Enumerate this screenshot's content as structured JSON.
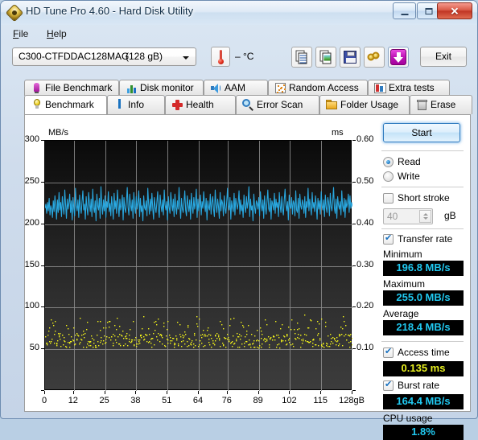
{
  "window": {
    "title": "HD Tune Pro 4.60 - Hard Disk Utility",
    "icon": "hdtune-logo-icon",
    "minimize": "",
    "maximize": "",
    "close": "✕"
  },
  "menu": {
    "items": [
      {
        "label": "File"
      },
      {
        "label": "Help"
      }
    ]
  },
  "toolbar": {
    "drive_name": "C300-CTFDDAC128MAG",
    "drive_size": "(128 gB)",
    "temperature": "– °C",
    "buttons": [
      {
        "name": "copy-text-icon"
      },
      {
        "name": "copy-image-icon"
      },
      {
        "name": "save-icon"
      },
      {
        "name": "links-icon"
      },
      {
        "name": "download-icon"
      }
    ],
    "exit_label": "Exit"
  },
  "tabs_top": [
    {
      "label": "File Benchmark",
      "icon": "file-benchmark-icon"
    },
    {
      "label": "Disk monitor",
      "icon": "bar-chart-icon"
    },
    {
      "label": "AAM",
      "icon": "speaker-icon"
    },
    {
      "label": "Random Access",
      "icon": "random-access-icon"
    },
    {
      "label": "Extra tests",
      "icon": "extra-tests-icon"
    }
  ],
  "tabs_bottom": [
    {
      "label": "Benchmark",
      "icon": "lightbulb-icon",
      "active": true
    },
    {
      "label": "Info",
      "icon": "info-icon",
      "active": false
    },
    {
      "label": "Health",
      "icon": "health-cross-icon",
      "active": false
    },
    {
      "label": "Error Scan",
      "icon": "magnifier-icon",
      "active": false
    },
    {
      "label": "Folder Usage",
      "icon": "folder-icon",
      "active": false
    },
    {
      "label": "Erase",
      "icon": "trash-icon",
      "active": false
    }
  ],
  "side": {
    "start_label": "Start",
    "read_label": "Read",
    "write_label": "Write",
    "read_selected": true,
    "short_stroke_label": "Short stroke",
    "short_stroke_checked": false,
    "short_stroke_value": "40",
    "short_stroke_unit": "gB",
    "transfer_rate_label": "Transfer rate",
    "transfer_rate_checked": true,
    "minimum_label": "Minimum",
    "minimum_value": "196.8 MB/s",
    "maximum_label": "Maximum",
    "maximum_value": "255.0 MB/s",
    "average_label": "Average",
    "average_value": "218.4 MB/s",
    "access_time_label": "Access time",
    "access_time_checked": true,
    "access_time_value": "0.135 ms",
    "burst_rate_label": "Burst rate",
    "burst_rate_checked": true,
    "burst_rate_value": "164.4 MB/s",
    "cpu_usage_label": "CPU usage",
    "cpu_usage_value": "1.8%"
  },
  "colors": {
    "transfer_line": "#29a8e0",
    "access_dots": "#f2f21a",
    "result_cyan": "#20c8f0",
    "result_yellow": "#e8f020",
    "accent": "#2f7bbf"
  },
  "chart_data": {
    "type": "line",
    "title": "",
    "xlabel": "",
    "ylabel": "MB/s",
    "y2label": "ms",
    "xlim": [
      0,
      128
    ],
    "ylim": [
      0,
      300
    ],
    "y2lim": [
      0.0,
      0.6
    ],
    "grid": true,
    "legend": "none",
    "xticks": [
      0,
      12,
      25,
      38,
      51,
      64,
      76,
      89,
      102,
      115,
      128
    ],
    "xtick_labels": [
      "0",
      "12",
      "25",
      "38",
      "51",
      "64",
      "76",
      "89",
      "102",
      "115",
      "128gB"
    ],
    "yticks": [
      0,
      50,
      100,
      150,
      200,
      250,
      300
    ],
    "ytick_labels": [
      "",
      "50",
      "100",
      "150",
      "200",
      "250",
      "300"
    ],
    "y2ticks": [
      0.0,
      0.1,
      0.2,
      0.3,
      0.4,
      0.5,
      0.6
    ],
    "y2tick_labels": [
      "",
      "0.10",
      "0.20",
      "0.30",
      "0.40",
      "0.50",
      "0.60"
    ],
    "series": [
      {
        "name": "Transfer rate",
        "type": "line",
        "axis": "left",
        "units": "MB/s",
        "color": "#29a8e0",
        "minimum": 196.8,
        "maximum": 255.0,
        "average": 218.4,
        "values": [
          219,
          224,
          213,
          226,
          216,
          231,
          211,
          222,
          218,
          208,
          228,
          215,
          234,
          221,
          206,
          229,
          214,
          238,
          217,
          226,
          209,
          233,
          220,
          212,
          241,
          223,
          207,
          230,
          218,
          225,
          236,
          214,
          228,
          205,
          232,
          219,
          210,
          243,
          222,
          216,
          229,
          208,
          235,
          221,
          213,
          227,
          240,
          217,
          224,
          206,
          233,
          219,
          211,
          238,
          225,
          215,
          230,
          209,
          242,
          220,
          214,
          228,
          204,
          236,
          222,
          217,
          231,
          207,
          245,
          223,
          212,
          229,
          216,
          234,
          208,
          227,
          220,
          239,
          215,
          225,
          210,
          233,
          221,
          206,
          237,
          218,
          228,
          213,
          241,
          224,
          209,
          230,
          217,
          222,
          235,
          205,
          232,
          219,
          214,
          227,
          244,
          220,
          211,
          236,
          223,
          216,
          229,
          207,
          238,
          221,
          213,
          233,
          218,
          226,
          240,
          209,
          231,
          215,
          222,
          204,
          234,
          220,
          217,
          228,
          210,
          243,
          224,
          212,
          230,
          216,
          237,
          219,
          206,
          232,
          221,
          214,
          226,
          239,
          218,
          208,
          235,
          222,
          215,
          229,
          211,
          241,
          223,
          217,
          227,
          205,
          233,
          220,
          213,
          238,
          224,
          216,
          230,
          209,
          236,
          221,
          212,
          228,
          218,
          244,
          222,
          207,
          231,
          219,
          214,
          226,
          240,
          217,
          210,
          234,
          223,
          215,
          229,
          206,
          237,
          221,
          213,
          232,
          218,
          225,
          242,
          208,
          230,
          216,
          222,
          235,
          211,
          227,
          219,
          239,
          224,
          215,
          231,
          205,
          228,
          220,
          217,
          236,
          212,
          226,
          233,
          218,
          209,
          241,
          223,
          214,
          230,
          221,
          207,
          238,
          216,
          229,
          225,
          210,
          234,
          219,
          213,
          227,
          243,
          222,
          217,
          232,
          206,
          228,
          220,
          215,
          237,
          211,
          231,
          224,
          218,
          226,
          240,
          212,
          229,
          216,
          223,
          208,
          235,
          221,
          214,
          233,
          219,
          227,
          245,
          209,
          230,
          217,
          222,
          204,
          236,
          220,
          213,
          228,
          225,
          218,
          232,
          210,
          239,
          223,
          216,
          229,
          207,
          234,
          221,
          212,
          227,
          241,
          219,
          215,
          231,
          206,
          228,
          224,
          217,
          237,
          213,
          230,
          220,
          226,
          209,
          238,
          222,
          214,
          233,
          218,
          211,
          229,
          242,
          223,
          216,
          227,
          205,
          235,
          221,
          219,
          232,
          212,
          228,
          225,
          210,
          240,
          217,
          214,
          231,
          207,
          236,
          222,
          218,
          229,
          224,
          213,
          233,
          208,
          227,
          220,
          243,
          216,
          230,
          221,
          211,
          238,
          219,
          226,
          215,
          234,
          223,
          206,
          231,
          218,
          228,
          212,
          239,
          222,
          217,
          229,
          209,
          235,
          220,
          214,
          232,
          226,
          210,
          237,
          221,
          216,
          228,
          244,
          219,
          213,
          230,
          207,
          233,
          223,
          218,
          227,
          211,
          240,
          222,
          215,
          231,
          208,
          229,
          220,
          225,
          236,
          214,
          234,
          219,
          226,
          221
        ]
      },
      {
        "name": "Access time",
        "type": "scatter",
        "axis": "right",
        "units": "ms",
        "color": "#f2f21a",
        "average": 0.135,
        "band_min": 0.105,
        "band_max": 0.15,
        "outlier_max": 0.185,
        "point_count": 520
      }
    ]
  }
}
